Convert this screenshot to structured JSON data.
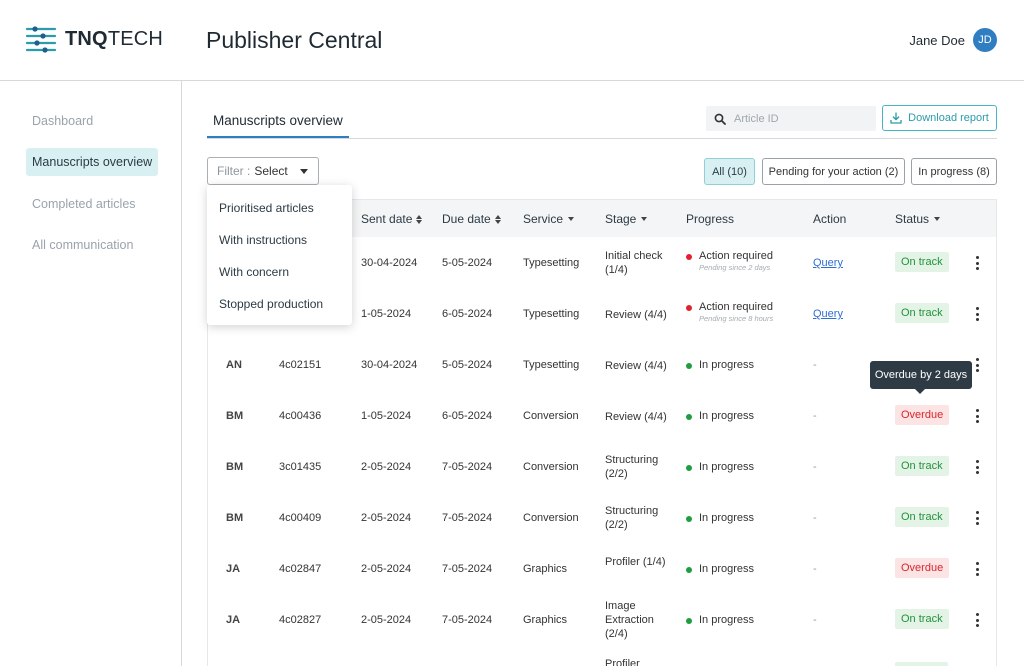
{
  "header": {
    "logo_bold": "TNQ",
    "logo_rest": "TECH",
    "app_title": "Publisher Central",
    "user_name": "Jane Doe",
    "user_initials": "JD"
  },
  "sidebar": {
    "items": [
      {
        "label": "Dashboard",
        "active": false
      },
      {
        "label": "Manuscripts overview",
        "active": true
      },
      {
        "label": "Completed articles",
        "active": false
      },
      {
        "label": "All communication",
        "active": false
      }
    ]
  },
  "main": {
    "tab_title": "Manuscripts overview",
    "search_placeholder": "Article ID",
    "download_label": "Download report",
    "filter_label": "Filter :",
    "filter_value": "Select",
    "pills": [
      "All (10)",
      "Pending for your action (2)",
      "In progress (8)"
    ]
  },
  "filter_menu": {
    "items": [
      "Prioritised articles",
      "With instructions",
      "With concern",
      "Stopped production"
    ]
  },
  "table": {
    "headers": {
      "sent_date": "Sent date",
      "due_date": "Due date",
      "service": "Service",
      "stage": "Stage",
      "progress": "Progress",
      "action": "Action",
      "status": "Status"
    },
    "rows": [
      {
        "editor": "",
        "article_id": "",
        "sent": "30-04-2024",
        "due": "5-05-2024",
        "service": "Typesetting",
        "stage": "Initial check (1/4)",
        "progress": "Action required",
        "progress_sub": "Pending since 2 days",
        "progress_color": "red",
        "action": "Query",
        "status": "On track"
      },
      {
        "editor": "",
        "article_id": "",
        "sent": "1-05-2024",
        "due": "6-05-2024",
        "service": "Typesetting",
        "stage": "Review (4/4)",
        "progress": "Action required",
        "progress_sub": "Pending since 8 hours",
        "progress_color": "red",
        "action": "Query",
        "status": "On track"
      },
      {
        "editor": "AN",
        "article_id": "4c02151",
        "sent": "30-04-2024",
        "due": "5-05-2024",
        "service": "Typesetting",
        "stage": "Review (4/4)",
        "progress": "In progress",
        "progress_sub": "",
        "progress_color": "green",
        "action": "-",
        "status": ""
      },
      {
        "editor": "BM",
        "article_id": "4c00436",
        "sent": "1-05-2024",
        "due": "6-05-2024",
        "service": "Conversion",
        "stage": "Review (4/4)",
        "progress": "In progress",
        "progress_sub": "",
        "progress_color": "green",
        "action": "-",
        "status": "Overdue"
      },
      {
        "editor": "BM",
        "article_id": "3c01435",
        "sent": "2-05-2024",
        "due": "7-05-2024",
        "service": "Conversion",
        "stage": "Structuring (2/2)",
        "progress": "In progress",
        "progress_sub": "",
        "progress_color": "green",
        "action": "-",
        "status": "On track"
      },
      {
        "editor": "BM",
        "article_id": "4c00409",
        "sent": "2-05-2024",
        "due": "7-05-2024",
        "service": "Conversion",
        "stage": "Structuring (2/2)",
        "progress": "In progress",
        "progress_sub": "",
        "progress_color": "green",
        "action": "-",
        "status": "On track"
      },
      {
        "editor": "JA",
        "article_id": "4c02847",
        "sent": "2-05-2024",
        "due": "7-05-2024",
        "service": "Graphics",
        "stage": "Profiler (1/4)",
        "progress": "In progress",
        "progress_sub": "",
        "progress_color": "green",
        "action": "-",
        "status": "Overdue"
      },
      {
        "editor": "JA",
        "article_id": "4c02827",
        "sent": "2-05-2024",
        "due": "7-05-2024",
        "service": "Graphics",
        "stage": "Image Extraction (2/4)",
        "progress": "In progress",
        "progress_sub": "",
        "progress_color": "green",
        "action": "-",
        "status": "On track"
      }
    ],
    "partial_row_stage": "Profiler"
  },
  "tooltip": {
    "text": "Overdue by 2 days"
  },
  "colors": {
    "brand": "#2a9cab",
    "accent_blue": "#2f7ec2",
    "ontrack_text": "#23913b",
    "overdue_text": "#d8262e"
  }
}
